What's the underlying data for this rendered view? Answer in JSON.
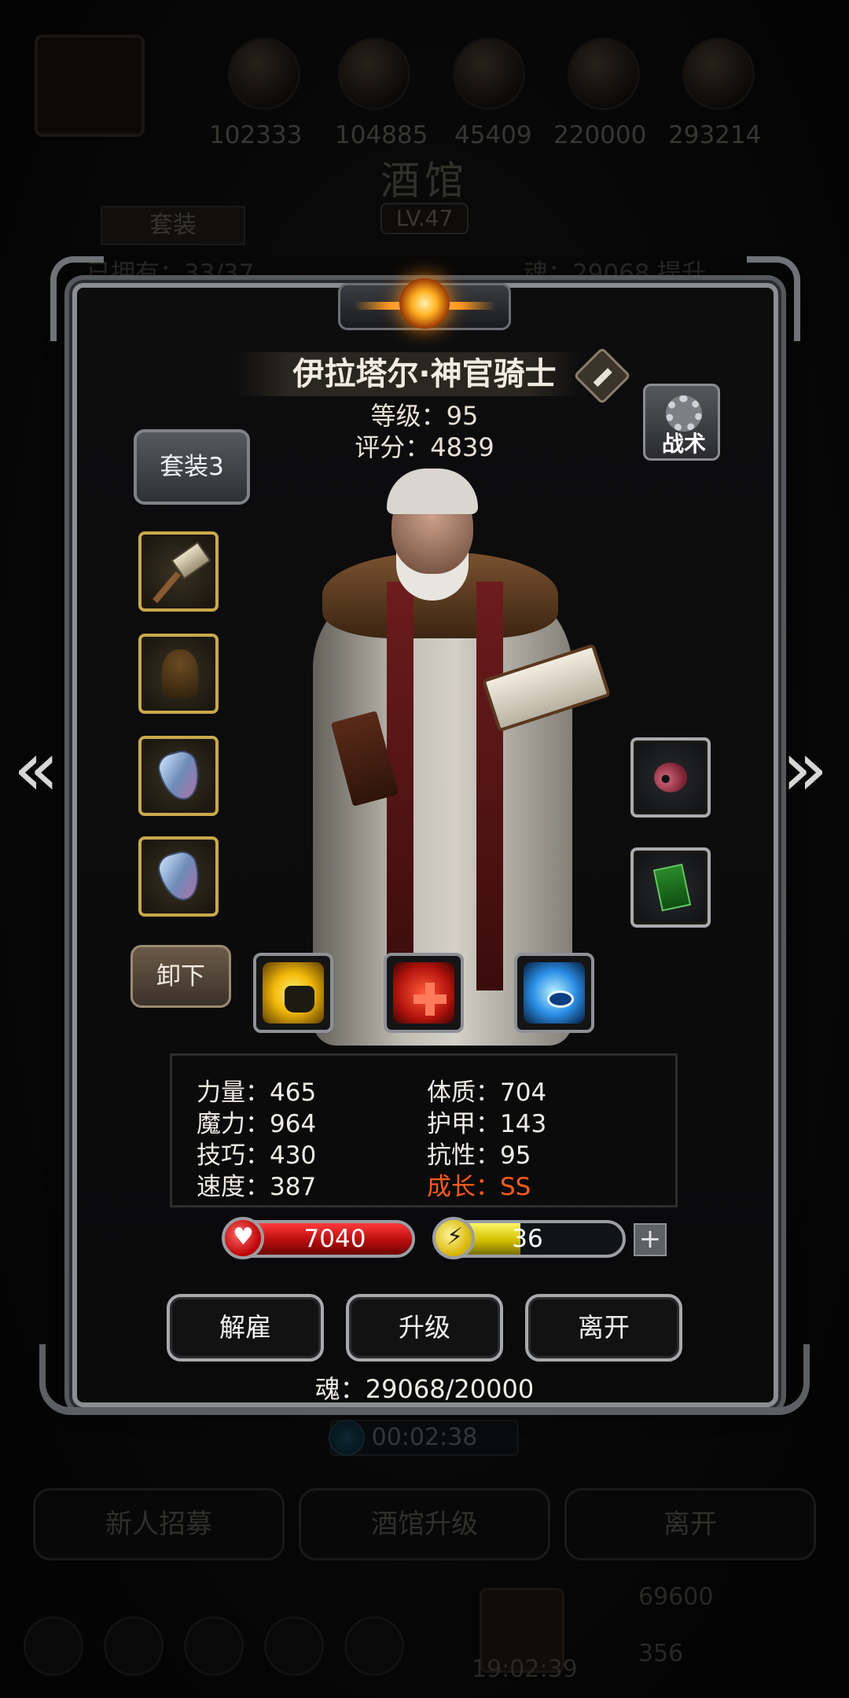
{
  "background": {
    "resources": [
      "102333",
      "104885",
      "45409",
      "220000",
      "293214"
    ],
    "tavern_title": "酒馆",
    "tavern_level": "LV.47",
    "set_tab": "套装",
    "roster_count": "已拥有：33/37",
    "soul_text": "魂：29068",
    "soul_btn": "提升",
    "timer": "00:02:38",
    "buttons": {
      "recruit": "新人招募",
      "upgrade": "酒馆升级",
      "leave": "离开"
    },
    "gold": "69600",
    "gems": "356",
    "clock": "19:02:39"
  },
  "hero": {
    "name": "伊拉塔尔·神官骑士",
    "level_text": "等级：95",
    "score_text": "评分：4839"
  },
  "buttons": {
    "tactics": "战术",
    "set": "套装3",
    "unequip": "卸下",
    "dismiss": "解雇",
    "upgrade": "升级",
    "leave": "离开",
    "plus": "+"
  },
  "equipment_left": [
    "hammer-icon",
    "cloak-icon",
    "shield-icon",
    "shield-icon"
  ],
  "equipment_right": [
    "eye-relic-icon",
    "green-card-icon"
  ],
  "skills": [
    "fist-skill-icon",
    "heal-cross-skill-icon",
    "eye-skill-icon"
  ],
  "stats": {
    "strength": "力量：465",
    "constitution": "体质：704",
    "magic": "魔力：964",
    "armor": "护甲：143",
    "skill": "技巧：430",
    "resistance": "抗性：95",
    "speed": "速度：387",
    "growth": "成长：SS"
  },
  "bars": {
    "hp": "7040",
    "hp_fraction": 1.0,
    "energy": "36",
    "energy_fraction": 0.45
  },
  "soul_footer": "魂：29068/20000",
  "colors": {
    "growth": "#ff5a1a",
    "hp": "#d01616",
    "energy": "#e6d800",
    "gold_border": "#c9a94d"
  }
}
